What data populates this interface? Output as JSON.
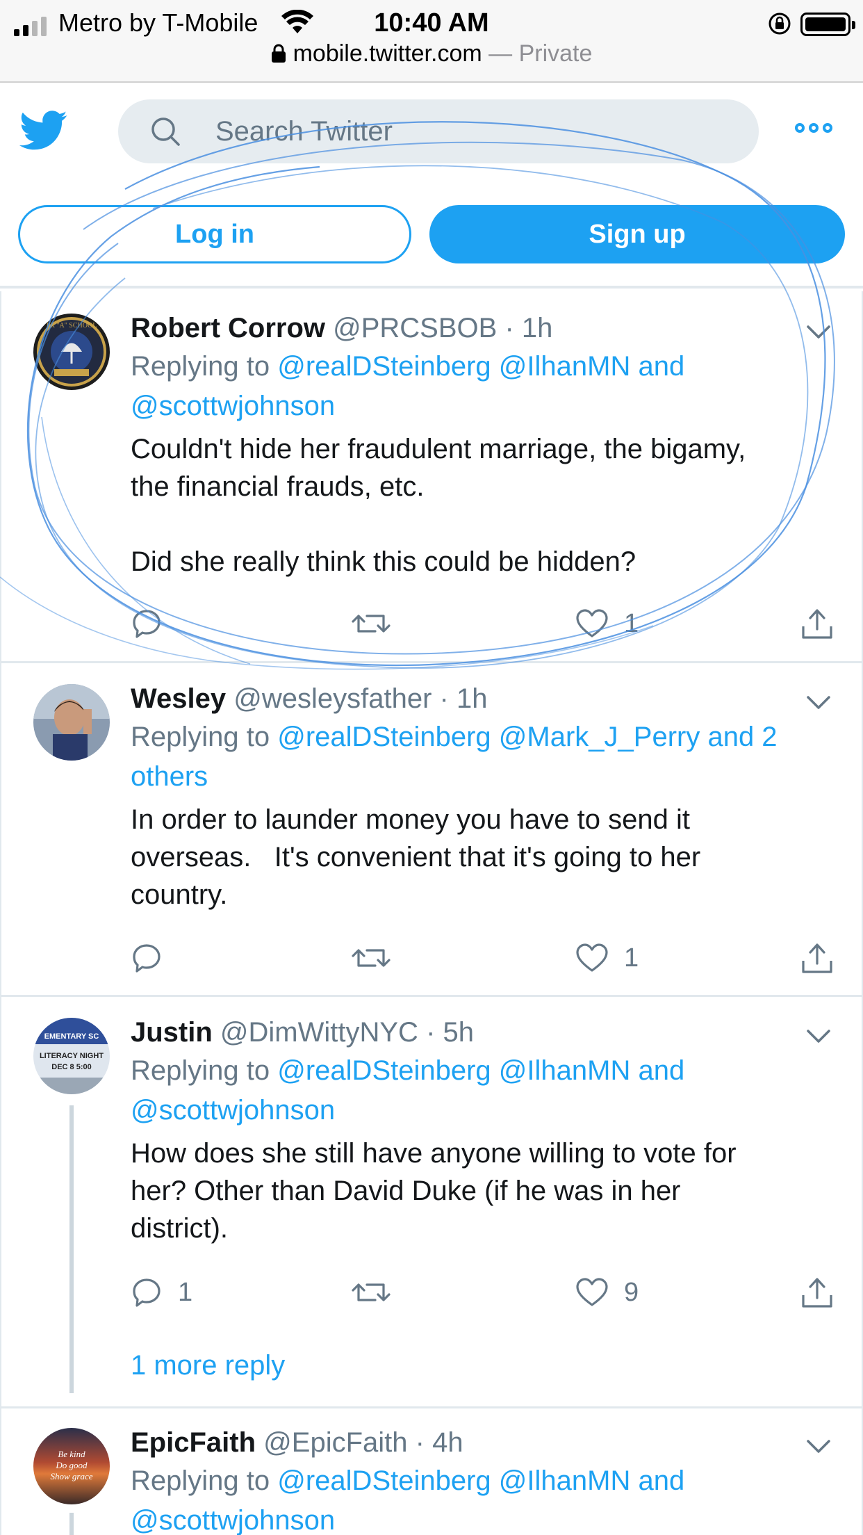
{
  "status_bar": {
    "carrier": "Metro by T-Mobile",
    "time": "10:40 AM",
    "url": "mobile.twitter.com",
    "private_label": " — Private"
  },
  "header": {
    "search_placeholder": "Search Twitter",
    "login_label": "Log in",
    "signup_label": "Sign up"
  },
  "colors": {
    "brand": "#1da1f2",
    "text": "#14171a",
    "muted": "#657786",
    "annotation": "#4a8fe0"
  },
  "tweets": [
    {
      "name": "Robert Corrow",
      "handle": "@PRCSBOB",
      "sep": "·",
      "age": "1h",
      "reply_prefix": "Replying to",
      "reply_line1": "@realDSteinberg @IlhanMN and",
      "reply_line2": "@scottwjohnson",
      "text": "Couldn't hide her fraudulent marriage, the bigamy,\nthe financial frauds, etc.\n\nDid she really think this could be hidden?",
      "replies": "",
      "retweets": "",
      "likes": "1"
    },
    {
      "name": "Wesley",
      "handle": "@wesleysfather",
      "sep": "·",
      "age": "1h",
      "reply_prefix": "Replying to",
      "reply_line1": "@realDSteinberg @Mark_J_Perry and 2",
      "reply_line2": "others",
      "text": "In order to launder money you have to send it\noverseas.   It's convenient that it's going to her\ncountry.",
      "replies": "",
      "retweets": "",
      "likes": "1"
    },
    {
      "name": "Justin",
      "handle": "@DimWittyNYC",
      "sep": "·",
      "age": "5h",
      "reply_prefix": "Replying to",
      "reply_line1": "@realDSteinberg @IlhanMN and",
      "reply_line2": "@scottwjohnson",
      "text": "How does she still have anyone willing to vote for\nher? Other than David Duke (if he was in her\ndistrict).",
      "replies": "1",
      "retweets": "",
      "likes": "9",
      "more_replies": "1 more reply"
    },
    {
      "name": "EpicFaith",
      "handle": "@EpicFaith",
      "sep": "·",
      "age": "4h",
      "reply_prefix": "Replying to",
      "reply_line1": "@realDSteinberg @IlhanMN and",
      "reply_line2": "@scottwjohnson"
    }
  ],
  "avatar_text": {
    "robert_badge": "PR \"A\" SCHOOL",
    "justin_sign_top": "EMENTARY SC",
    "justin_sign": "LITERACY NIGHT",
    "justin_sign_date": "DEC 8  5:00",
    "epicfaith_line1": "Be kind",
    "epicfaith_line2": "Do good",
    "epicfaith_line3": "Show grace"
  }
}
